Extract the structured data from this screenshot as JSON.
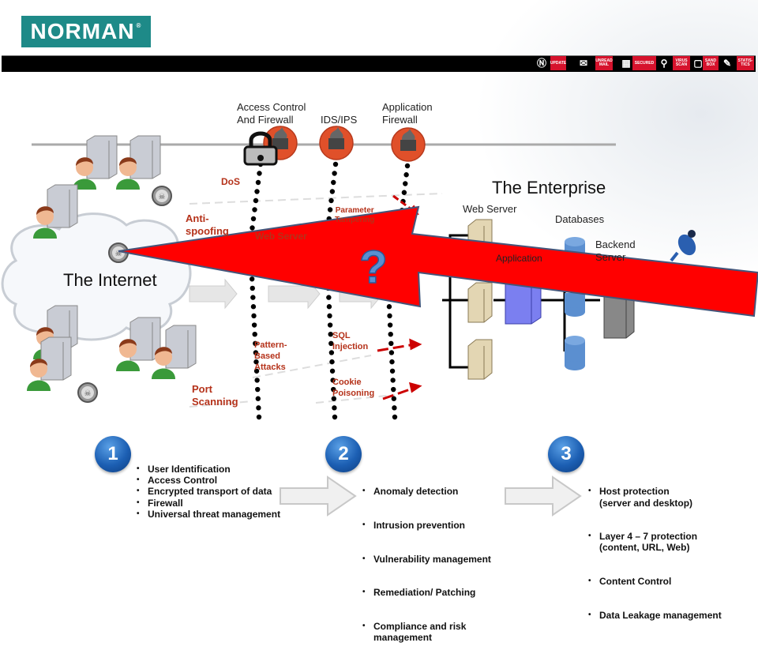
{
  "header": {
    "logo_text": "NORMAN",
    "nav_items": [
      {
        "label": "",
        "icon": "norman-shield-icon",
        "style": "icon"
      },
      {
        "label": "UPDATE",
        "style": "red"
      },
      {
        "label": "",
        "icon": "mail-icon",
        "style": "icon"
      },
      {
        "label": "UNREAD MAIL",
        "style": "red"
      },
      {
        "label": "",
        "icon": "film-icon",
        "style": "icon"
      },
      {
        "label": "SECURED",
        "style": "red"
      },
      {
        "label": "",
        "icon": "search-icon",
        "style": "icon"
      },
      {
        "label": "VIRUS SCAN",
        "style": "red"
      },
      {
        "label": "",
        "icon": "document-icon",
        "style": "icon"
      },
      {
        "label": "SAND BOX",
        "style": "red"
      },
      {
        "label": "",
        "icon": "clipboard-icon",
        "style": "icon"
      },
      {
        "label": "STATIS-TICS",
        "style": "red"
      }
    ]
  },
  "defenses": {
    "access_control": "Access Control\nAnd Firewall",
    "idsips": "IDS/IPS",
    "app_firewall": "Application\nFirewall"
  },
  "attacks": {
    "dos": "DoS",
    "anti_spoofing": "Anti-\nspoofing",
    "web_server": "Web Server",
    "parameter_tampering": "Parameter\nTampering",
    "pattern_based": "Pattern-\nBased\nAttacks",
    "sql_injection": "SQL\nInjection",
    "cookie_poisoning": "Cookie\nPoisoning",
    "port_scanning": "Port\nScanning"
  },
  "zones": {
    "internet": "The Internet",
    "enterprise": "The Enterprise"
  },
  "enterprise_labels": {
    "web_server": "Web Server",
    "application": "Application",
    "databases": "Databases",
    "backend_server": "Backend\nServer"
  },
  "steps": [
    {
      "number": "1",
      "items": [
        "User Identification",
        "Access Control",
        "Encrypted transport of data",
        "Firewall",
        "Universal threat management"
      ]
    },
    {
      "number": "2",
      "items": [
        "Anomaly detection",
        "Intrusion prevention",
        "Vulnerability management",
        "Remediation/ Patching",
        "Compliance and risk\nmanagement"
      ]
    },
    {
      "number": "3",
      "items": [
        "Host protection\n(server and desktop)",
        "Layer 4 – 7 protection\n(content, URL, Web)",
        "Content Control",
        "Data Leakage management"
      ]
    }
  ],
  "colors": {
    "brand_teal": "#1e8a88",
    "nav_red": "#d6122c",
    "attack_text": "#b5321a",
    "big_arrow": "#ff0000",
    "badge_blue": "#1c5fb3"
  }
}
